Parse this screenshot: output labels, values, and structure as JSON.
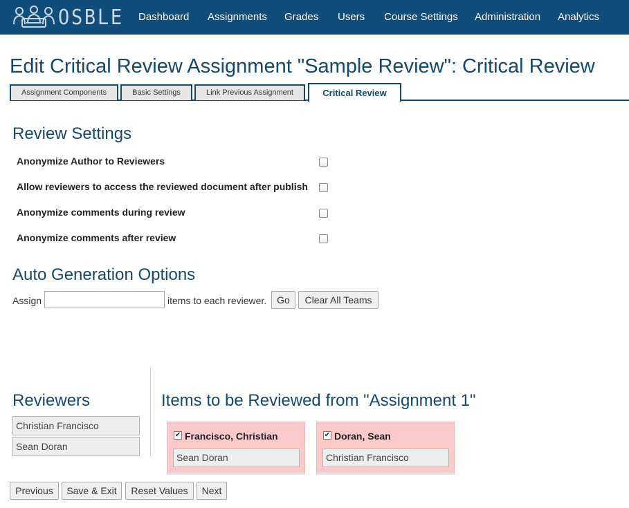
{
  "navbar": {
    "logo_text": "OSBLE",
    "items": [
      {
        "label": "Dashboard"
      },
      {
        "label": "Assignments"
      },
      {
        "label": "Grades"
      },
      {
        "label": "Users"
      },
      {
        "label": "Course Settings"
      },
      {
        "label": "Administration"
      },
      {
        "label": "Analytics"
      }
    ],
    "background_color": "#114d7a"
  },
  "page_title": "Edit Critical Review Assignment \"Sample Review\": Critical Review",
  "tabs": [
    {
      "label": "Assignment Components",
      "active": false
    },
    {
      "label": "Basic Settings",
      "active": false
    },
    {
      "label": "Link Previous Assignment",
      "active": false
    },
    {
      "label": "Critical Review",
      "active": true
    }
  ],
  "review_settings": {
    "heading": "Review Settings",
    "options": [
      {
        "label": "Anonymize Author to Reviewers",
        "checked": false
      },
      {
        "label": "Allow reviewers to access the reviewed document after publish",
        "checked": false
      },
      {
        "label": "Anonymize comments during review",
        "checked": false
      },
      {
        "label": "Anonymize comments after review",
        "checked": false
      }
    ]
  },
  "auto_generation": {
    "heading": "Auto Generation Options",
    "assign_label": "Assign",
    "input_value": "",
    "suffix_label": "items to each reviewer.",
    "go_label": "Go",
    "clear_label": "Clear All Teams"
  },
  "reviewers": {
    "heading": "Reviewers",
    "items": [
      "Christian Francisco",
      "Sean Doran"
    ]
  },
  "items_to_review": {
    "heading": "Items to be Reviewed from \"Assignment 1\"",
    "teams": [
      {
        "name": "Francisco, Christian",
        "checked": true,
        "reviewer": "Sean Doran"
      },
      {
        "name": "Doran, Sean",
        "checked": true,
        "reviewer": "Christian Francisco"
      }
    ],
    "card_color": "#fccaca"
  },
  "footer_buttons": {
    "previous": "Previous",
    "save_exit": "Save & Exit",
    "reset": "Reset Values",
    "next": "Next"
  },
  "colors": {
    "heading": "#14496e"
  }
}
